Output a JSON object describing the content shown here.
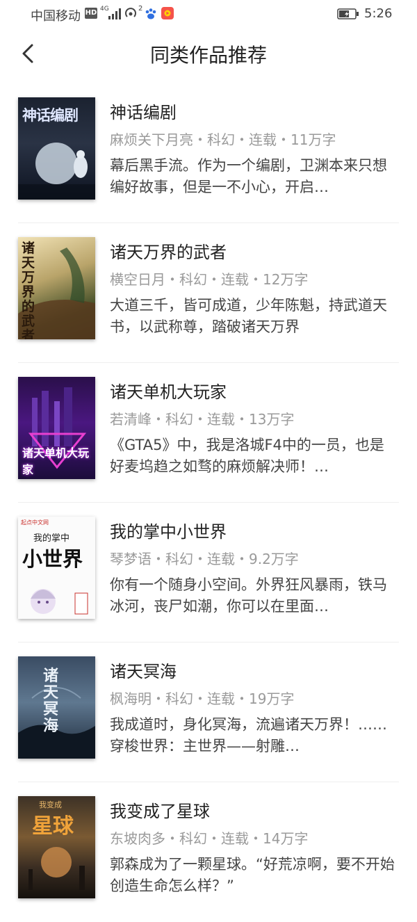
{
  "status_bar": {
    "carrier": "中国移动",
    "hd": "HD",
    "network": "4G",
    "hotspot_count": "2",
    "time": "5:26"
  },
  "header": {
    "title": "同类作品推荐",
    "back_icon": "chevron-left-icon"
  },
  "books": [
    {
      "title": "神话编剧",
      "meta": "麻烦关下月亮・科幻・连载・11万字",
      "description": "幕后黑手流。作为一个编剧，卫渊本来只想编好故事，但是一不小心，开启…",
      "cover_title": "神话编剧"
    },
    {
      "title": "诸天万界的武者",
      "meta": "横空日月・科幻・连载・12万字",
      "description": "大道三千，皆可成道，少年陈魁，持武道天书，以武称尊，踏破诸天万界",
      "cover_title": "诸天万界的武者"
    },
    {
      "title": "诸天单机大玩家",
      "meta": "若清峰・科幻・连载・13万字",
      "description": "《GTA5》中，我是洛城F4中的一员，也是好麦坞趋之如骛的麻烦解决师！…",
      "cover_title": "诸天单机大玩家"
    },
    {
      "title": "我的掌中小世界",
      "meta": "琴梦语・科幻・连载・9.2万字",
      "description": "你有一个随身小空间。外界狂风暴雨，铁马冰河，丧尸如潮，你可以在里面…",
      "cover_title": "小世界",
      "cover_subtitle": "我的掌中",
      "cover_brand": "起点中文网"
    },
    {
      "title": "诸天冥海",
      "meta": "枫海明・科幻・连载・19万字",
      "description": "我成道时，身化冥海，流遍诸天万界！……穿梭世界：主世界——射雕…",
      "cover_title": "诸天冥海"
    },
    {
      "title": "我变成了星球",
      "meta": "东坡肉多・科幻・连载・14万字",
      "description": "郭森成为了一颗星球。“好荒凉啊，要不开始创造生命怎么样？”",
      "cover_title": "星球",
      "cover_subtitle": "我变成"
    }
  ]
}
